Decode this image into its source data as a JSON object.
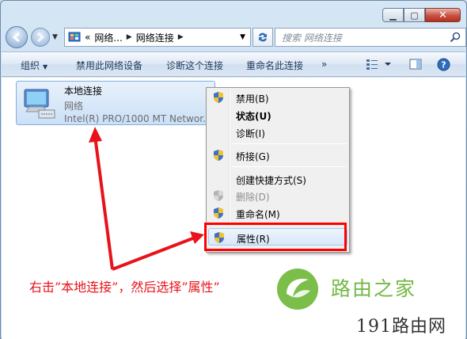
{
  "window": {
    "caption_buttons": [
      "minimize",
      "maximize",
      "close"
    ]
  },
  "nav": {
    "breadcrumb_overflow": "«",
    "breadcrumb": [
      "网络...",
      "网络连接"
    ],
    "search_placeholder": "搜索 网络连接"
  },
  "toolbar": {
    "organize": "组织",
    "disable": "禁用此网络设备",
    "diagnose": "诊断这个连接",
    "rename": "重命名此连接",
    "more": "»"
  },
  "connection": {
    "name": "本地连接",
    "status": "网络",
    "device": "Intel(R) PRO/1000 MT Networ..."
  },
  "context_menu": {
    "items": [
      {
        "label": "禁用(B)",
        "shield": true
      },
      {
        "label": "状态(U)",
        "shield": false,
        "bold": true
      },
      {
        "label": "诊断(I)",
        "shield": false
      },
      {
        "label": "桥接(G)",
        "shield": true
      },
      {
        "label": "创建快捷方式(S)",
        "shield": false
      },
      {
        "label": "删除(D)",
        "shield": true,
        "disabled": true
      },
      {
        "label": "重命名(M)",
        "shield": true
      },
      {
        "label": "属性(R)",
        "shield": true,
        "highlighted": true
      }
    ]
  },
  "annotation": {
    "text": "右击”本地连接”，然后选择”属性”"
  },
  "watermark": {
    "title": "路由之家",
    "bottom": "191路由网"
  },
  "colors": {
    "annotation_red": "#e8121a",
    "watermark_green": "#74b844",
    "menu_highlight_border": "#ff0000"
  }
}
